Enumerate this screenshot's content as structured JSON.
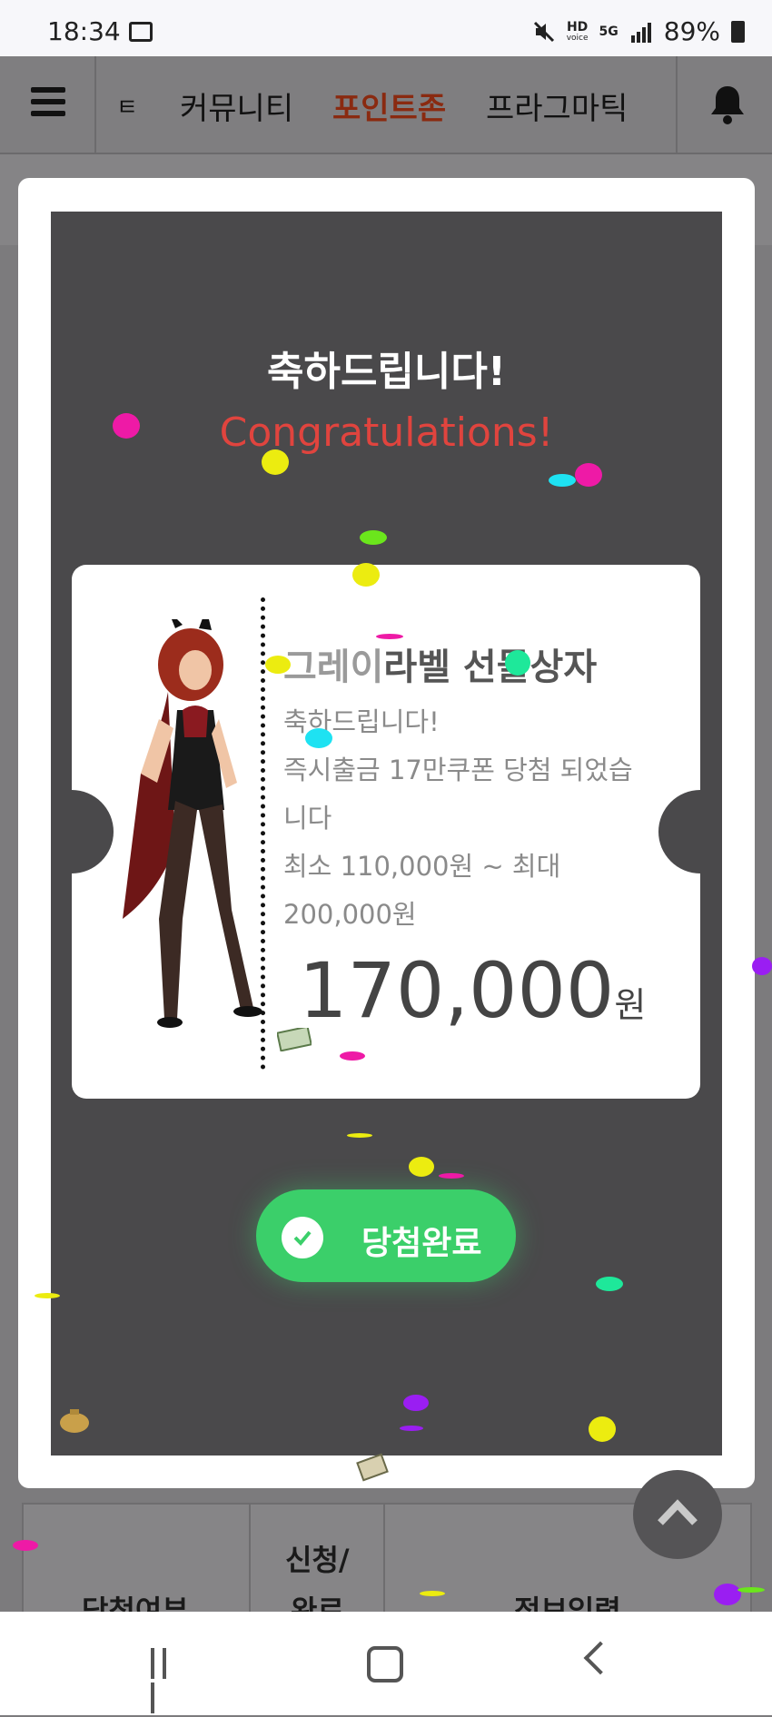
{
  "status_bar": {
    "time": "18:34",
    "hd_label": "HD",
    "voice_label": "voice",
    "net_label": "5G",
    "battery": "89%"
  },
  "nav": {
    "partial_item": "ㅌ",
    "items": [
      {
        "label": "커뮤니티",
        "active": false
      },
      {
        "label": "포인트존",
        "active": true
      },
      {
        "label": "프라그마틱",
        "active": false
      }
    ]
  },
  "modal": {
    "congrats_ko": "축하드립니다!",
    "congrats_en": "Congratulations!",
    "coupon": {
      "title_gray": "그레이",
      "title_rest": "라벨 선물상자",
      "line1": "축하드립니다!",
      "line2": "즉시출금 17만쿠폰 당첨 되었습",
      "line3": "니다",
      "line4": "최소 110,000원 ~ 최대",
      "line5": "200,000원",
      "amount": "170,000",
      "amount_unit": "원"
    },
    "button_label": "당첨완료"
  },
  "table_under": {
    "headers": [
      "당첨여부",
      "신청/",
      "완료",
      "정보입력"
    ]
  },
  "colors": {
    "accent_green": "#3bcf6a",
    "congrats_red": "#e0443e",
    "nav_active": "#8a2a10"
  }
}
